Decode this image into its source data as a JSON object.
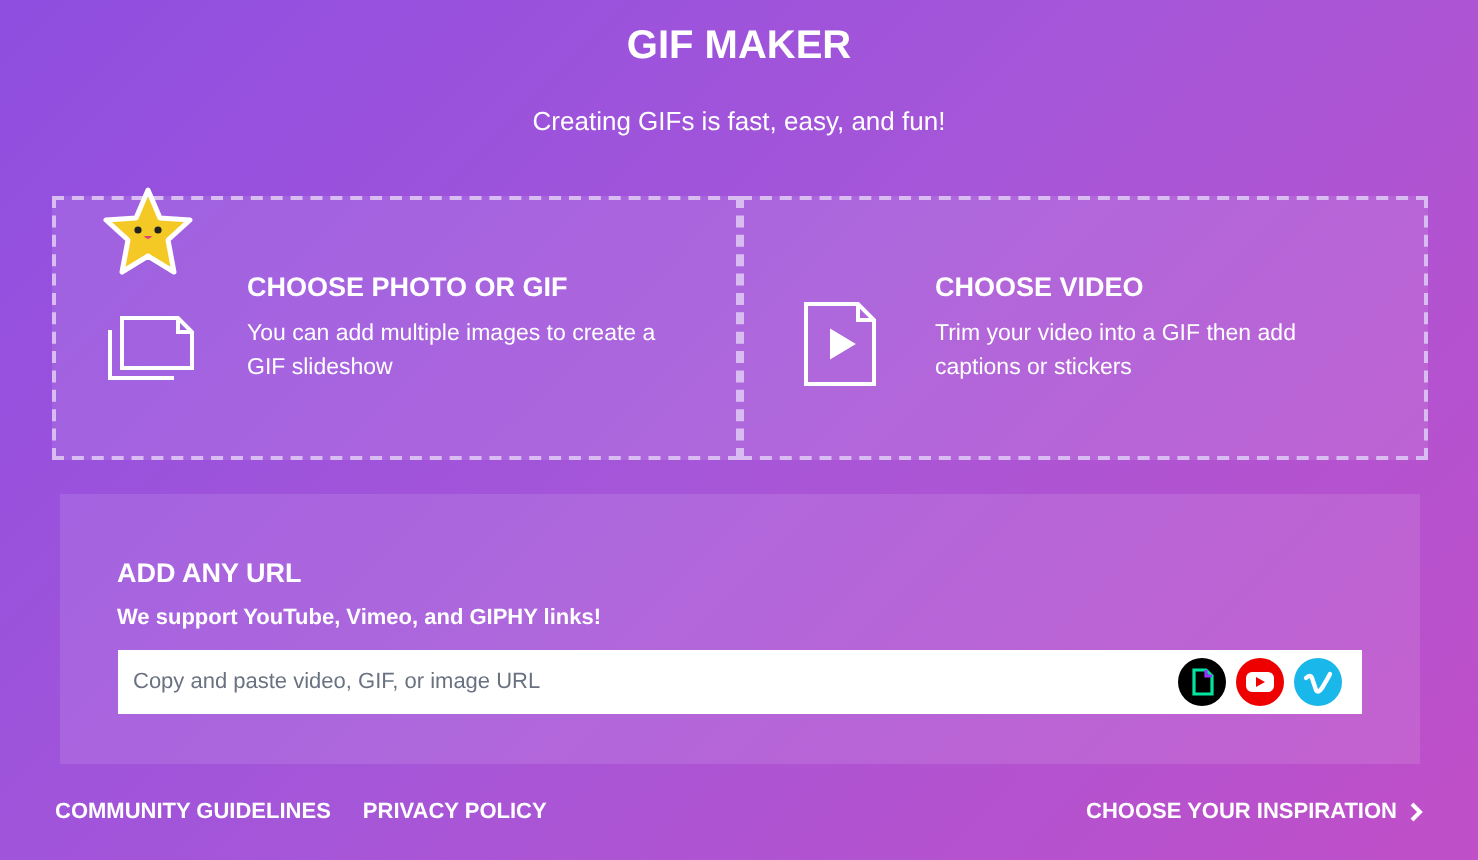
{
  "header": {
    "title": "GIF MAKER",
    "subtitle": "Creating GIFs is fast, easy, and fun!"
  },
  "upload_options": [
    {
      "kind": "photo",
      "title": "CHOOSE PHOTO OR GIF",
      "description": "You can add multiple images to create a GIF slideshow",
      "sticker": true
    },
    {
      "kind": "video",
      "title": "CHOOSE VIDEO",
      "description": "Trim your video into a GIF then add captions or stickers",
      "sticker": false
    }
  ],
  "url_panel": {
    "title": "ADD ANY URL",
    "subtitle": "We support YouTube, Vimeo, and GIPHY links!",
    "placeholder": "Copy and paste video, GIF, or image URL",
    "sources": [
      {
        "kind": "giphy"
      },
      {
        "kind": "youtube"
      },
      {
        "kind": "vimeo"
      }
    ]
  },
  "footer": {
    "links": [
      "COMMUNITY GUIDELINES",
      "PRIVACY POLICY"
    ],
    "inspiration": "CHOOSE YOUR INSPIRATION"
  }
}
